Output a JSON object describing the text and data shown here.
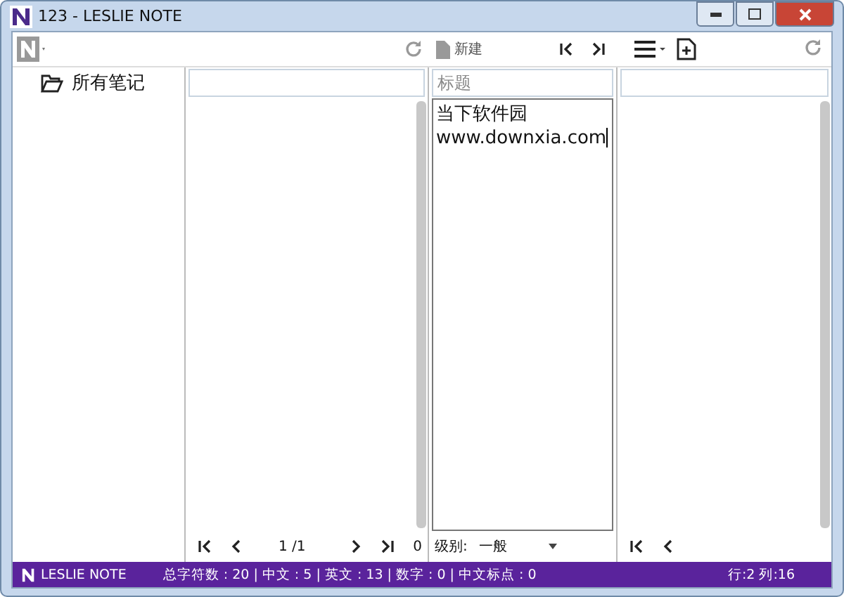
{
  "window": {
    "title": "123 - LESLIE NOTE"
  },
  "sidebar": {
    "items": [
      {
        "label": "所有笔记"
      }
    ]
  },
  "toolbar": {
    "new_button": "新建"
  },
  "list_pane": {
    "page": "1 /1",
    "count": "0"
  },
  "editor": {
    "title_placeholder": "标题",
    "body_lines": [
      "当下软件园",
      "www.downxia.com"
    ],
    "level_label": "级别:",
    "level_value": "一般"
  },
  "status_bar": {
    "app_name": "LESLIE NOTE",
    "stats": "总字符数 : 20 | 中文 : 5 | 英文 : 13 | 数字 : 0 | 中文标点 : 0",
    "position": "行:2 列:16"
  }
}
